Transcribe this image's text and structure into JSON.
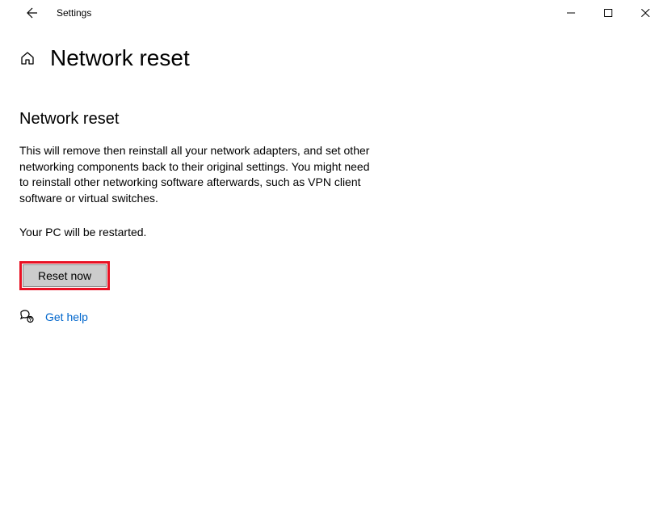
{
  "window": {
    "title": "Settings"
  },
  "header": {
    "page_title": "Network reset"
  },
  "main": {
    "section_heading": "Network reset",
    "description": "This will remove then reinstall all your network adapters, and set other networking components back to their original settings. You might need to reinstall other networking software afterwards, such as VPN client software or virtual switches.",
    "restart_notice": "Your PC will be restarted.",
    "reset_button_label": "Reset now"
  },
  "help": {
    "link_text": "Get help"
  },
  "highlight": {
    "color": "#e81123"
  }
}
